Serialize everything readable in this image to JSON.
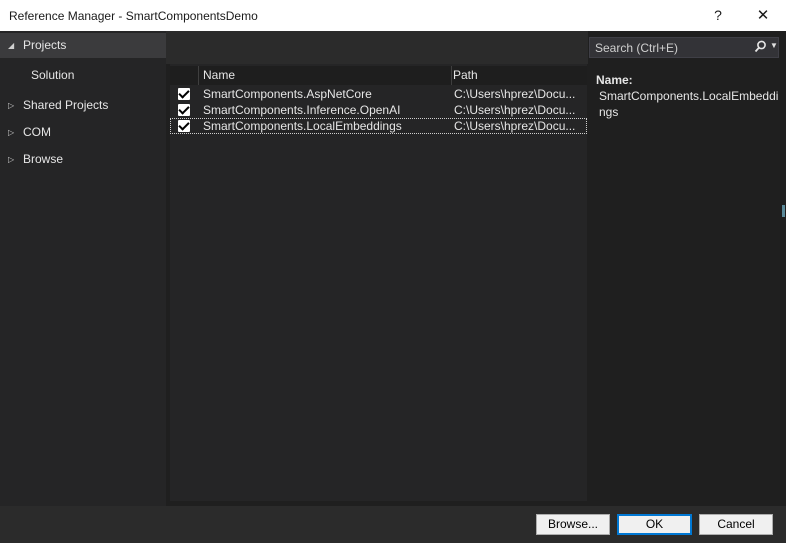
{
  "window": {
    "title": "Reference Manager - SmartComponentsDemo",
    "help": "?",
    "close": "✕"
  },
  "sidebar": {
    "items": [
      {
        "label": "Projects",
        "arrow": "◢"
      },
      {
        "label": "Solution"
      },
      {
        "label": "Shared Projects",
        "arrow": "▷"
      },
      {
        "label": "COM",
        "arrow": "▷"
      },
      {
        "label": "Browse",
        "arrow": "▷"
      }
    ]
  },
  "search": {
    "placeholder": "Search (Ctrl+E)",
    "icon": "search-icon"
  },
  "table": {
    "columns": [
      "Name",
      "Path"
    ],
    "rows": [
      {
        "checked": true,
        "name": "SmartComponents.AspNetCore",
        "path": "C:\\Users\\hprez\\Docu..."
      },
      {
        "checked": true,
        "name": "SmartComponents.Inference.OpenAI",
        "path": "C:\\Users\\hprez\\Docu..."
      },
      {
        "checked": true,
        "name": "SmartComponents.LocalEmbeddings",
        "path": "C:\\Users\\hprez\\Docu..."
      }
    ]
  },
  "details": {
    "name_label": "Name:",
    "name_value": "SmartComponents.LocalEmbeddings"
  },
  "buttons": {
    "browse": "Browse...",
    "ok": "OK",
    "cancel": "Cancel"
  }
}
